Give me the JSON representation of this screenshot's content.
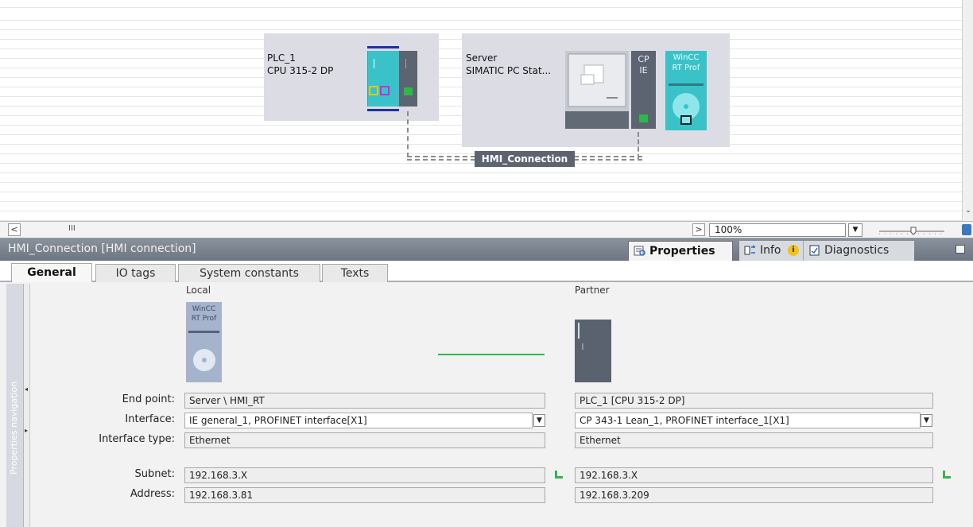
{
  "network": {
    "plc": {
      "name": "PLC_1",
      "type": "CPU 315-2 DP"
    },
    "server": {
      "name": "Server",
      "type": "SIMATIC PC Stat...",
      "cp_line1": "CP",
      "cp_line2": "IE",
      "wincc_line1": "WinCC",
      "wincc_line2": "RT Prof"
    },
    "connection_label": "HMI_Connection",
    "scroll_left_glyph": "<",
    "scroll_thumb_glyph": "III",
    "scroll_right_glyph": ">",
    "zoom_value": "100%"
  },
  "inspector": {
    "title": "HMI_Connection [HMI connection]",
    "tabs": {
      "properties": "Properties",
      "info": "Info",
      "diagnostics": "Diagnostics"
    }
  },
  "subtabs": {
    "general": "General",
    "io_tags": "IO tags",
    "system_constants": "System constants",
    "texts": "Texts"
  },
  "properties_navigation": "Properties navigation",
  "connection": {
    "local_header": "Local",
    "partner_header": "Partner",
    "local_icon_line1": "WinCC",
    "local_icon_line2": "RT Prof",
    "labels": {
      "end_point": "End point:",
      "interface": "Interface:",
      "interface_type": "Interface type:",
      "subnet": "Subnet:",
      "address": "Address:"
    },
    "local": {
      "end_point": "Server \\ HMI_RT",
      "interface": "IE general_1, PROFINET interface[X1]",
      "interface_type": "Ethernet",
      "subnet": "192.168.3.X",
      "address": "192.168.3.81"
    },
    "partner": {
      "end_point": "PLC_1 [CPU 315-2 DP]",
      "interface": "CP 343-1 Lean_1, PROFINET interface_1[X1]",
      "interface_type": "Ethernet",
      "subnet": "192.168.3.X",
      "address": "192.168.3.209"
    }
  },
  "colors": {
    "header_bg": "#7b838e",
    "link_green": "#2db84a",
    "device_teal": "#39c3c9"
  }
}
